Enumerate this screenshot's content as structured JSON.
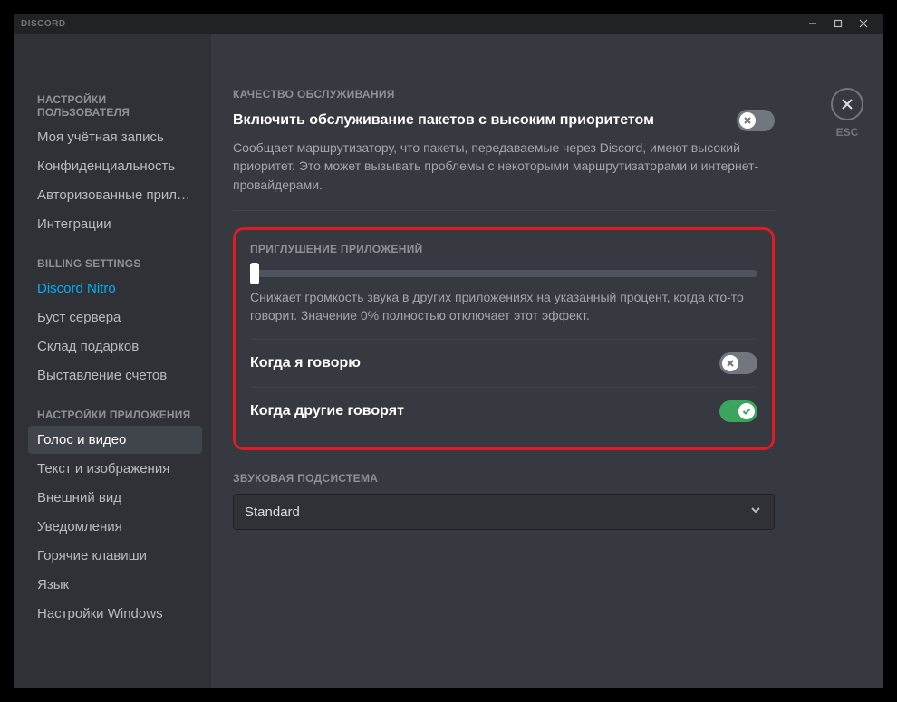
{
  "brand": "DISCORD",
  "esc_label": "ESC",
  "sidebar": {
    "group1_header": "НАСТРОЙКИ ПОЛЬЗОВАТЕЛЯ",
    "group1": [
      "Моя учётная запись",
      "Конфиденциальность",
      "Авторизованные прил…",
      "Интеграции"
    ],
    "group2_header": "BILLING SETTINGS",
    "group2": [
      "Discord Nitro",
      "Буст сервера",
      "Склад подарков",
      "Выставление счетов"
    ],
    "group3_header": "НАСТРОЙКИ ПРИЛОЖЕНИЯ",
    "group3": [
      "Голос и видео",
      "Текст и изображения",
      "Внешний вид",
      "Уведомления",
      "Горячие клавиши",
      "Язык",
      "Настройки Windows"
    ]
  },
  "qos": {
    "header": "КАЧЕСТВО ОБСЛУЖИВАНИЯ",
    "title": "Включить обслуживание пакетов с высоким приоритетом",
    "desc": "Сообщает маршрутизатору, что пакеты, передаваемые через Discord, имеют высокий приоритет. Это может вызывать проблемы с некоторыми маршрутизаторами и интернет-провайдерами.",
    "enabled": false
  },
  "attenuation": {
    "header": "ПРИГЛУШЕНИЕ ПРИЛОЖЕНИЙ",
    "slider_value": 0,
    "desc": "Снижает громкость звука в других приложениях на указанный процент, когда кто-то говорит. Значение 0% полностью отключает этот эффект.",
    "when_i_speak_label": "Когда я говорю",
    "when_i_speak": false,
    "when_others_speak_label": "Когда другие говорят",
    "when_others_speak": true
  },
  "subsystem": {
    "header": "ЗВУКОВАЯ ПОДСИСТЕМА",
    "value": "Standard"
  }
}
